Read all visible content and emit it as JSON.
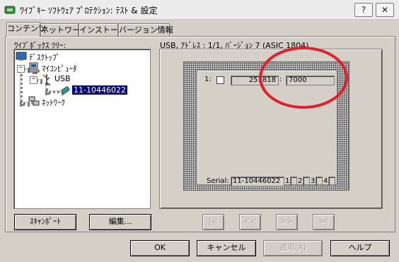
{
  "window": {
    "title": "ﾜｲﾌﾞｷｰ ｿﾌﾄｳｪｱ ﾌﾟﾛﾃｸｼｮﾝ: ﾃｽﾄ & 設定",
    "help_button": "?",
    "close_button": "✕"
  },
  "tabs": [
    {
      "label": "コンテンツ",
      "active": true
    },
    {
      "label": "ネットワーク",
      "active": false
    },
    {
      "label": "インストール",
      "active": false
    },
    {
      "label": "バージョン情報",
      "active": false
    }
  ],
  "tree": {
    "label": "ﾜｲﾌﾞﾎﾞｯｸｽ ﾂﾘｰ:",
    "items": [
      {
        "label": "ﾃﾞｽｸﾄｯﾌﾟ",
        "icon": "desktop-icon"
      },
      {
        "label": "ﾏｲｺﾝﾋﾟｭｰﾀ",
        "icon": "computer-icon",
        "expander": "−"
      },
      {
        "label": "USB",
        "icon": "usb-icon",
        "expander": "−"
      },
      {
        "label": "11-10446022",
        "icon": "dongle-icon",
        "selected": true
      },
      {
        "label": "ﾈｯﾄﾜｰｸ",
        "icon": "network-icon",
        "expander": "+"
      }
    ]
  },
  "info": {
    "label": "USB, ｱﾄﾞﾚｽ : 1/1, ﾊﾞｰｼﾞｮﾝ 7 (ASIC 1804)"
  },
  "key": {
    "slot_number": "1:",
    "code": "251818",
    "separator": ":",
    "value": "7000",
    "serial_label": "Serial:",
    "serial_value": "11-10446022",
    "ports": [
      "1",
      "2",
      "3",
      "4"
    ]
  },
  "buttons": {
    "scan_port": "ｽｷｬﾝﾎﾟｰﾄ",
    "edit": "編集...",
    "nav_first": "|<",
    "nav_prev": "<<",
    "nav_next": ">>",
    "nav_last": ">|",
    "ok": "OK",
    "cancel": "キャンセル",
    "apply": "適用(A)",
    "help": "ヘルプ"
  },
  "colors": {
    "dialog_bg": "#d4d0c8",
    "selection": "#000080",
    "annotation": "#e0202a"
  }
}
